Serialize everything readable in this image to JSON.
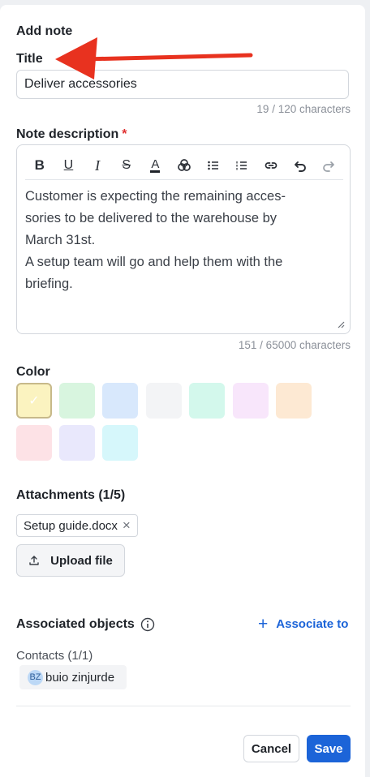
{
  "form": {
    "heading": "Add note",
    "title_label": "Title",
    "title_value": "Deliver accessories",
    "title_counter": "19 / 120 characters",
    "desc_label": "Note description",
    "desc_required": "*",
    "desc_lines": [
      "Customer is expecting the remaining acces-",
      "sories to be delivered to the warehouse by",
      "March 31st.",
      "A setup team will go and help them with the",
      "briefing."
    ],
    "desc_counter": "151 / 65000 characters",
    "toolbar": [
      "bold",
      "underline",
      "italic",
      "strikethrough",
      "text-color",
      "highlight",
      "bullet-list",
      "numbered-list",
      "link",
      "undo",
      "redo"
    ]
  },
  "color": {
    "label": "Color",
    "selected_index": 0,
    "swatches": [
      "#fbf3c0",
      "#d8f5df",
      "#d8e8fc",
      "#f3f4f6",
      "#d3f8ec",
      "#f8e6fb",
      "#fde9d3",
      "#fde2e6",
      "#e9e8fc",
      "#d6f7fb"
    ],
    "selected_check": "✓"
  },
  "attachments": {
    "label": "Attachments (1/5)",
    "file_name": "Setup guide.docx",
    "remove_symbol": "×",
    "upload_label": "Upload file"
  },
  "associated": {
    "label": "Associated objects",
    "associate_label": "Associate to",
    "contacts_label": "Contacts (1/1)",
    "contact_initials": "BZ",
    "contact_name": "buio zinjurde"
  },
  "footer": {
    "cancel_label": "Cancel",
    "save_label": "Save"
  },
  "annotation": {
    "arrow_color": "#e8321f"
  }
}
